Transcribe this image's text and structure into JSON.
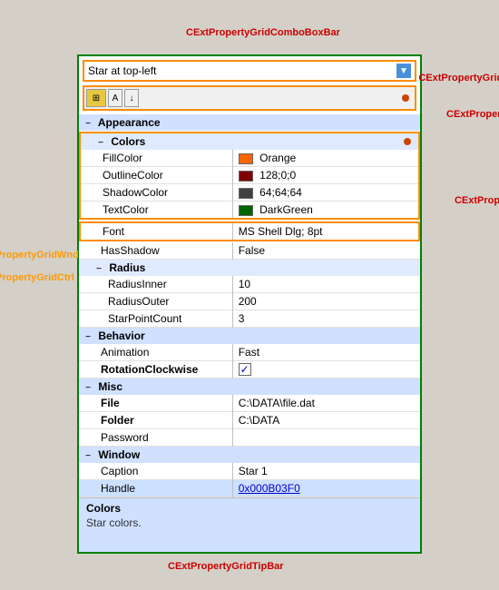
{
  "labels": {
    "comboboxbar": "CExtPropertyGridComboBoxBar",
    "toolbar": "CExtPropertyGridToolBar",
    "category": "CExtPropertyCategory",
    "value": "CExtPropertyValue",
    "wnd": "CExtPropertyGridWnd",
    "ctrl": "CExtPropertyGridCtrl",
    "tipbar": "CExtPropertyGridTipBar"
  },
  "combobox": {
    "value": "Star at top-left",
    "arrow": "▼"
  },
  "toolbar": {
    "btn1": "⊞",
    "btn2": "A",
    "btn3": "↓"
  },
  "categories": [
    {
      "name": "Appearance",
      "expanded": true,
      "subcategories": [
        {
          "name": "Colors",
          "expanded": true,
          "outlined": true,
          "properties": [
            {
              "name": "FillColor",
              "value": "Orange",
              "color": "#ff6600",
              "hasColor": true
            },
            {
              "name": "OutlineColor",
              "value": "128;0;0",
              "color": "#800000",
              "hasColor": true
            },
            {
              "name": "ShadowColor",
              "value": "64;64;64",
              "color": "#404040",
              "hasColor": true
            },
            {
              "name": "TextColor",
              "value": "DarkGreen",
              "color": "#006400",
              "hasColor": true
            }
          ]
        }
      ],
      "properties": [
        {
          "name": "Font",
          "value": "MS Shell Dlg; 8pt",
          "outlined": true,
          "bold": false
        },
        {
          "name": "HasShadow",
          "value": "False",
          "outlined": false,
          "bold": false
        }
      ],
      "subcategories2": [
        {
          "name": "Radius",
          "expanded": true,
          "properties": [
            {
              "name": "RadiusInner",
              "value": "10"
            },
            {
              "name": "RadiusOuter",
              "value": "200"
            },
            {
              "name": "StarPointCount",
              "value": "3"
            }
          ]
        }
      ]
    },
    {
      "name": "Behavior",
      "expanded": true,
      "properties": [
        {
          "name": "Animation",
          "value": "Fast",
          "bold": false
        },
        {
          "name": "RotationClockwise",
          "value": "✓",
          "bold": true,
          "isCheck": true
        }
      ]
    },
    {
      "name": "Misc",
      "expanded": true,
      "properties": [
        {
          "name": "File",
          "value": "C:\\DATA\\file.dat",
          "bold": true
        },
        {
          "name": "Folder",
          "value": "C:\\DATA",
          "bold": true
        },
        {
          "name": "Password",
          "value": "",
          "bold": false
        }
      ]
    },
    {
      "name": "Window",
      "expanded": true,
      "properties": [
        {
          "name": "Caption",
          "value": "Star 1",
          "bold": false
        },
        {
          "name": "Handle",
          "value": "0x000B03F0",
          "bold": false,
          "isLink": true
        }
      ]
    }
  ],
  "tipbar": {
    "title": "Colors",
    "description": "Star colors."
  }
}
